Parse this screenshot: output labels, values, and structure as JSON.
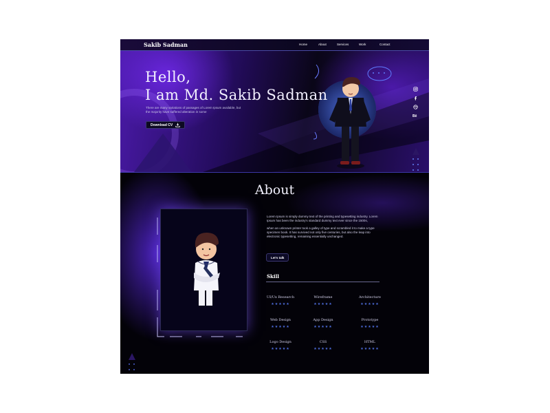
{
  "nav": {
    "brand": "Sakib Sadman",
    "links": [
      "Home",
      "About",
      "Services",
      "Work",
      "Contact"
    ]
  },
  "hero": {
    "greeting": "Hello,",
    "name_line": "I am Md. Sakib Sadman",
    "intro": "There are many variations of passages of Lorem Ipsum available, but the majority have suffered alteration in some",
    "download_label": "Download CV"
  },
  "social": [
    "instagram-icon",
    "facebook-icon",
    "dribbble-icon",
    "behance-icon"
  ],
  "about": {
    "title": "About",
    "paragraphs": [
      "Lorem Ipsum is simply dummy text of the printing and typesetting industry. Lorem Ipsum has been the industry's standard dummy text ever since the 1500s,",
      "when an unknown printer took a galley of type and scrambled it to make a type specimen book. It has survived not only five centuries, but also the leap into electronic typesetting, remaining essentially unchanged."
    ],
    "talk_label": "Let's talk",
    "skill_heading": "Skill"
  },
  "skills": [
    {
      "name": "UI/Ux Research",
      "stars": "★★★★★",
      "rating": 5
    },
    {
      "name": "Wireframe",
      "stars": "★★★★★",
      "rating": 5
    },
    {
      "name": "Architecture",
      "stars": "★★★★★",
      "rating": 5
    },
    {
      "name": "Web Design",
      "stars": "★★★★★",
      "rating": 5
    },
    {
      "name": "App Design",
      "stars": "★★★★★",
      "rating": 5
    },
    {
      "name": "Prototype",
      "stars": "★★★★★",
      "rating": 5
    },
    {
      "name": "Logo Design",
      "stars": "★★★★★",
      "rating": 5
    },
    {
      "name": "CSS",
      "stars": "★★★★★",
      "rating": 5
    },
    {
      "name": "HTML",
      "stars": "★★★★★",
      "rating": 5
    }
  ],
  "colors": {
    "accent_purple": "#5a20d0",
    "deep_bg": "#040310",
    "star_blue": "#4f6fe0"
  }
}
